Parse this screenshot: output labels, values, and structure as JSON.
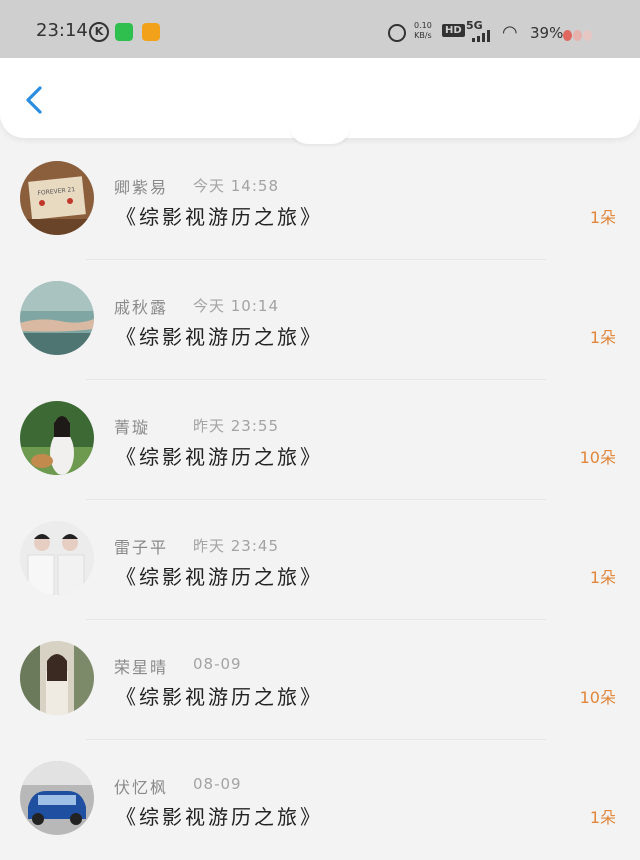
{
  "status_bar": {
    "time": "23:14",
    "k_badge": "K",
    "net_speed_value": "0.10",
    "net_speed_unit": "KB/s",
    "hd": "HD",
    "network": "5G",
    "battery": "39%"
  },
  "header": {
    "back_icon": "chevron-left-icon",
    "accent_color": "#2b8de0"
  },
  "list": [
    {
      "name": "卿紫易",
      "time": "今天 14:58",
      "title": "《综影视游历之旅》",
      "count": "1朵"
    },
    {
      "name": "戚秋露",
      "time": "今天 10:14",
      "title": "《综影视游历之旅》",
      "count": "1朵"
    },
    {
      "name": "菁璇",
      "time": "昨天 23:55",
      "title": "《综影视游历之旅》",
      "count": "10朵"
    },
    {
      "name": "雷子平",
      "time": "昨天 23:45",
      "title": "《综影视游历之旅》",
      "count": "1朵"
    },
    {
      "name": "荣星晴",
      "time": "08-09",
      "title": "《综影视游历之旅》",
      "count": "10朵"
    },
    {
      "name": "伏忆枫",
      "time": "08-09",
      "title": "《综影视游历之旅》",
      "count": "1朵"
    }
  ],
  "avatars": {
    "row0_text": "FOREVER 21"
  },
  "colors": {
    "count": "#e2863a",
    "status_bar_bg": "#cfcfcf"
  }
}
